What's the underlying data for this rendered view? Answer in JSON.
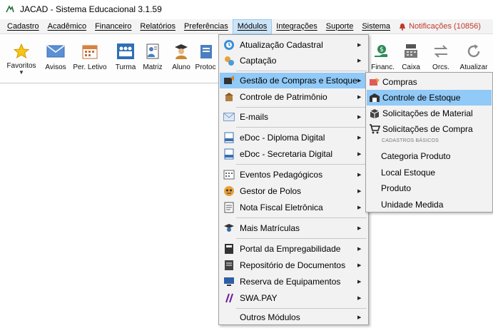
{
  "window": {
    "title": "JACAD - Sistema Educacional 3.1.59"
  },
  "menubar": {
    "items": [
      "Cadastro",
      "Acadêmico",
      "Financeiro",
      "Relatórios",
      "Preferências",
      "Módulos",
      "Integrações",
      "Suporte",
      "Sistema"
    ],
    "active": "Módulos",
    "notifications_label": "Notificações (10856)"
  },
  "toolbar": {
    "favoritos": "Favoritos",
    "avisos": "Avisos",
    "per_letivo": "Per. Letivo",
    "turma": "Turma",
    "matriz": "Matriz",
    "aluno": "Aluno",
    "protoc": "Protoc",
    "financ": "l Financ.",
    "caixa": "Caixa",
    "orcs": "Orcs.",
    "atualizar": "Atualizar"
  },
  "modulos_menu": {
    "items": [
      {
        "label": "Atualização Cadastral",
        "icon": "atualizacao-icon"
      },
      {
        "label": "Captação",
        "icon": "captacao-icon"
      },
      {
        "label": "Gestão de Compras e Estoque",
        "icon": "compras-estoque-icon"
      },
      {
        "label": "Controle de Patrimônio",
        "icon": "patrimonio-icon"
      },
      {
        "label": "E-mails",
        "icon": "email-icon"
      },
      {
        "label": "eDoc - Diploma Digital",
        "icon": "edoc-icon"
      },
      {
        "label": "eDoc - Secretaria Digital",
        "icon": "edoc-icon"
      },
      {
        "label": "Eventos Pedagógicos",
        "icon": "eventos-icon"
      },
      {
        "label": "Gestor de Polos",
        "icon": "polos-icon"
      },
      {
        "label": "Nota Fiscal Eletrônica",
        "icon": "nota-fiscal-icon"
      },
      {
        "label": "Mais Matrículas",
        "icon": "matriculas-icon"
      },
      {
        "label": "Portal da Empregabilidade",
        "icon": "portal-icon"
      },
      {
        "label": "Repositório de Documentos",
        "icon": "repositorio-icon"
      },
      {
        "label": "Reserva de Equipamentos",
        "icon": "reserva-icon"
      },
      {
        "label": "SWA.PAY",
        "icon": "swapay-icon"
      },
      {
        "label": "Outros Módulos",
        "icon": ""
      }
    ],
    "hovered": "Gestão de Compras e Estoque"
  },
  "submenu": {
    "items": [
      {
        "label": "Compras",
        "icon": "compras-icon"
      },
      {
        "label": "Controle de Estoque",
        "icon": "estoque-icon"
      },
      {
        "label": "Solicitações de Material",
        "icon": "material-icon"
      },
      {
        "label": "Solicitações de Compra",
        "icon": "cart-icon"
      }
    ],
    "section_header": "CADASTROS BÁSICOS",
    "basic": [
      {
        "label": "Categoria Produto"
      },
      {
        "label": "Local Estoque"
      },
      {
        "label": "Produto"
      },
      {
        "label": "Unidade Medida"
      }
    ],
    "hovered": "Controle de Estoque"
  }
}
